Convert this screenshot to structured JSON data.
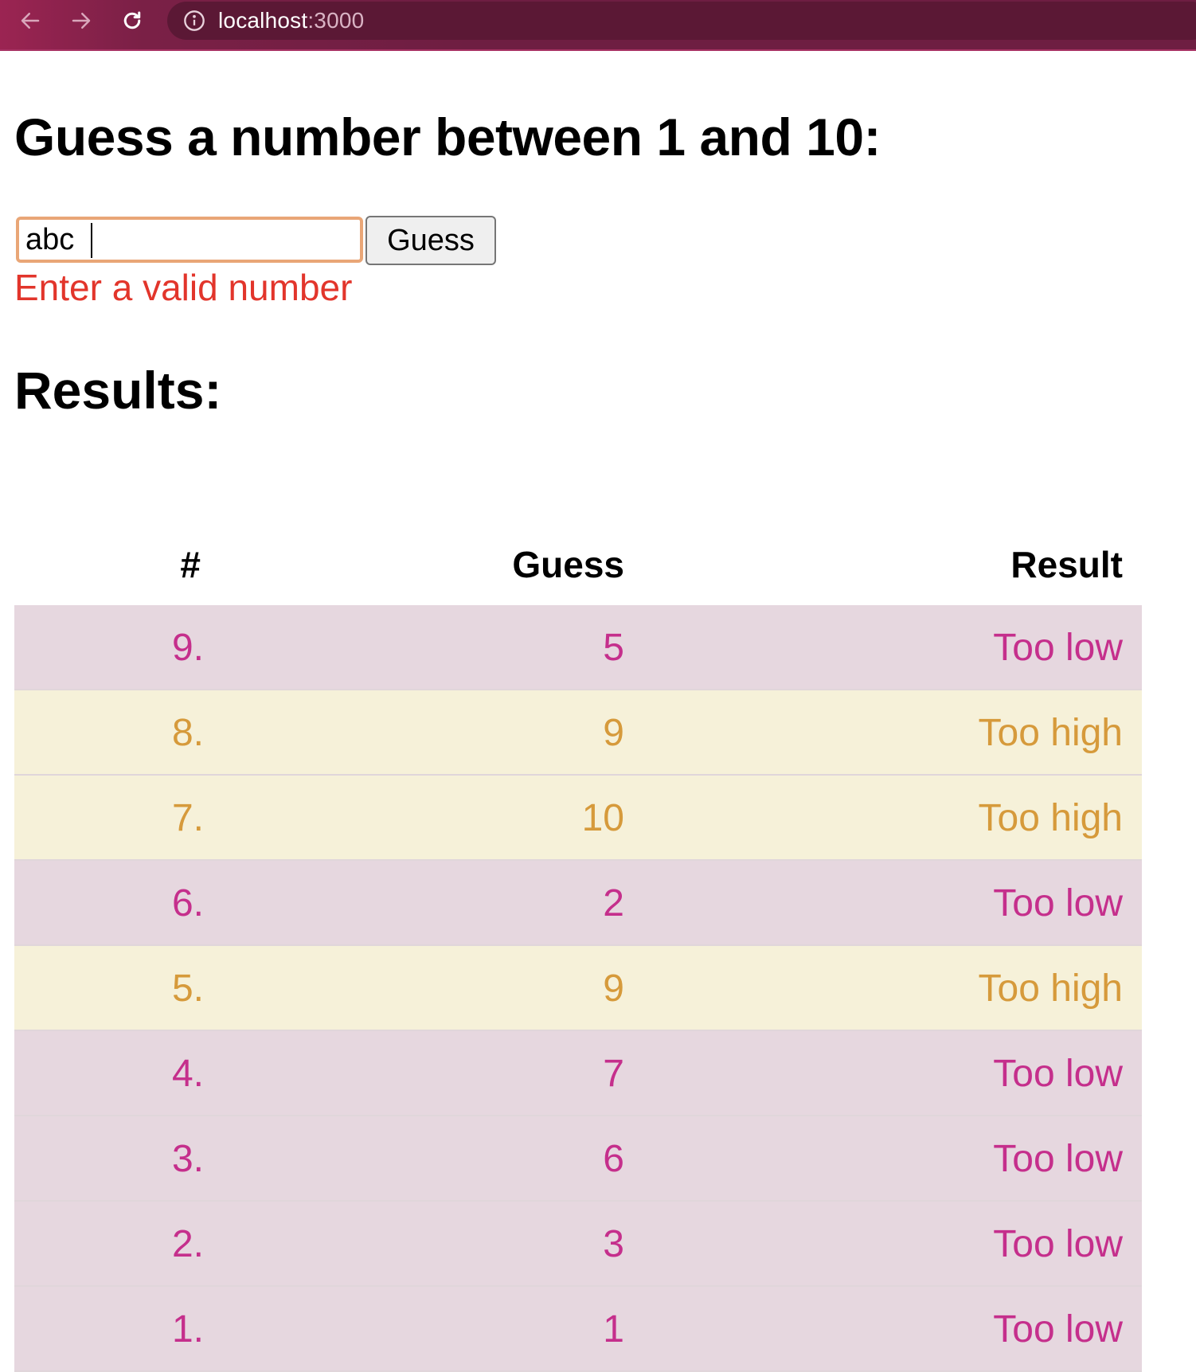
{
  "browser": {
    "url_host": "localhost",
    "url_port": ":3000"
  },
  "page": {
    "title": "Guess a number between 1 and 10:",
    "input_value": "abc",
    "button_label": "Guess",
    "error": "Enter a valid number",
    "results_heading": "Results:"
  },
  "table": {
    "headers": [
      "#",
      "Guess",
      "Result"
    ],
    "rows": [
      {
        "num": "9.",
        "guess": "5",
        "result": "Too low",
        "kind": "low"
      },
      {
        "num": "8.",
        "guess": "9",
        "result": "Too high",
        "kind": "high"
      },
      {
        "num": "7.",
        "guess": "10",
        "result": "Too high",
        "kind": "high"
      },
      {
        "num": "6.",
        "guess": "2",
        "result": "Too low",
        "kind": "low"
      },
      {
        "num": "5.",
        "guess": "9",
        "result": "Too high",
        "kind": "high"
      },
      {
        "num": "4.",
        "guess": "7",
        "result": "Too low",
        "kind": "low"
      },
      {
        "num": "3.",
        "guess": "6",
        "result": "Too low",
        "kind": "low"
      },
      {
        "num": "2.",
        "guess": "3",
        "result": "Too low",
        "kind": "low"
      },
      {
        "num": "1.",
        "guess": "1",
        "result": "Too low",
        "kind": "low"
      }
    ]
  },
  "colors": {
    "too_low_text": "#c52f8c",
    "too_low_bg": "#e6d7df",
    "too_high_text": "#d69a3b",
    "too_high_bg": "#f6f1d9",
    "error": "#e2352b"
  },
  "icons": {
    "back": "arrow-left-icon",
    "forward": "arrow-right-icon",
    "reload": "reload-icon",
    "info": "info-icon"
  }
}
